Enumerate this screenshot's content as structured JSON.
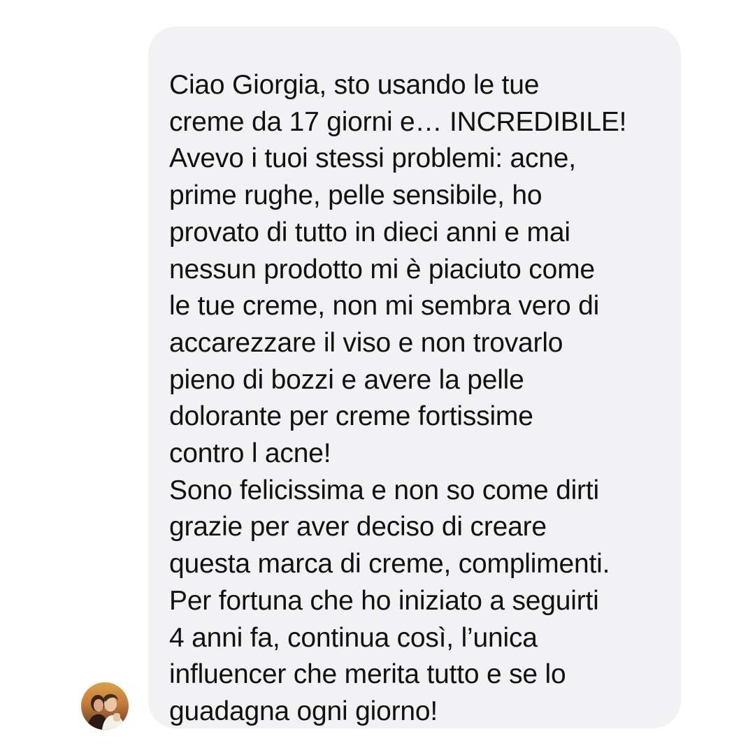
{
  "message": {
    "lines": [
      "Ciao Giorgia, sto usando le tue",
      "creme da 17 giorni e… INCREDIBILE!",
      "Avevo i tuoi stessi problemi: acne,",
      "prime rughe, pelle sensibile, ho",
      "provato di tutto in dieci anni e mai",
      "nessun prodotto mi è piaciuto come",
      "le tue creme, non mi sembra vero di",
      "accarezzare il viso e non trovarlo",
      "pieno di bozzi e avere la pelle",
      "dolorante per creme fortissime",
      "contro l acne!",
      "Sono felicissima e non so come dirti",
      "grazie per aver deciso di creare",
      "questa marca di creme, complimenti.",
      "Per fortuna che ho iniziato a seguirti",
      "4 anni fa, continua così, l’unica",
      "influencer che merita tutto e se lo",
      "guadagna ogni giorno!"
    ]
  },
  "colors": {
    "bubble_background": "#f2f2f4",
    "text": "#111111",
    "page_background": "#ffffff"
  },
  "icons": {
    "avatar": "sender-profile-photo"
  }
}
